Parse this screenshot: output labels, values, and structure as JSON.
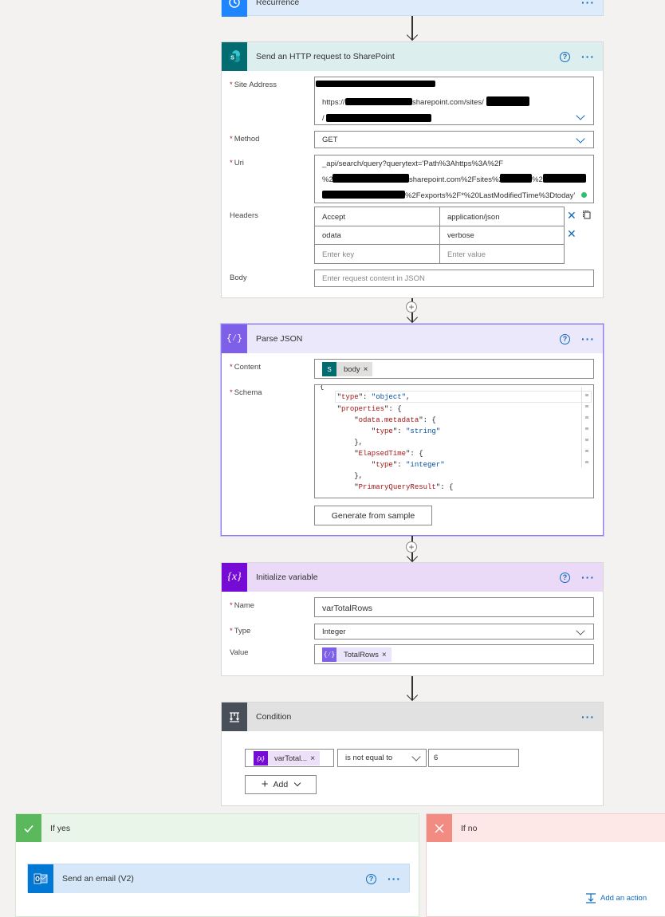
{
  "recurrence": {
    "title": "Recurrence"
  },
  "sharepoint": {
    "title": "Send an HTTP request to SharePoint",
    "site_address_label": "Site Address",
    "site_line2": "https://",
    "site_line2b": "sharepoint.com/sites/",
    "site_line3": "/",
    "method_label": "Method",
    "method_value": "GET",
    "uri_label": "Uri",
    "uri_line1": "_api/search/query?querytext='Path%3Ahttps%3A%2F",
    "uri_line2a": "%2F",
    "uri_line2b": "sharepoint.com%2Fsites%2F",
    "uri_line2c": "%2F",
    "uri_line3": "%2Fexports%2F*%20LastModifiedTime%3Dtoday'",
    "headers_label": "Headers",
    "headers": [
      {
        "key": "Accept",
        "value": "application/json"
      },
      {
        "key": "odata",
        "value": "verbose"
      }
    ],
    "key_placeholder": "Enter key",
    "value_placeholder": "Enter value",
    "body_label": "Body",
    "body_placeholder": "Enter request content in JSON"
  },
  "parse_json": {
    "title": "Parse JSON",
    "content_label": "Content",
    "content_token": "body",
    "schema_label": "Schema",
    "schema_lines": [
      "{",
      "    \"type\": \"object\",",
      "    \"properties\": {",
      "        \"odata.metadata\": {",
      "            \"type\": \"string\"",
      "        },",
      "        \"ElapsedTime\": {",
      "            \"type\": \"integer\"",
      "        },",
      "        \"PrimaryQueryResult\": {"
    ],
    "generate_button": "Generate from sample"
  },
  "init_variable": {
    "title": "Initialize variable",
    "name_label": "Name",
    "name_value": "varTotalRows",
    "type_label": "Type",
    "type_value": "Integer",
    "value_label": "Value",
    "value_token": "TotalRows"
  },
  "condition": {
    "title": "Condition",
    "left_token": "varTotal...",
    "operator": "is not equal to",
    "right_value": "6",
    "add_button": "Add"
  },
  "if_yes": {
    "title": "If yes",
    "action_title": "Send an email (V2)"
  },
  "if_no": {
    "title": "If no",
    "add_action": "Add an action"
  },
  "colors": {
    "sharepoint": "#036c70",
    "parse_json": "#7e5fe7",
    "variable": "#770bd6",
    "condition": "#484f58",
    "yes": "#5cb85c",
    "no": "#f28b82",
    "outlook": "#0078d4",
    "link": "#0f6cbd"
  },
  "icons": [
    "recurrence-clock-icon",
    "sharepoint-icon",
    "parse-json-icon",
    "variable-icon",
    "condition-icon",
    "check-icon",
    "close-icon",
    "outlook-icon",
    "add-action-icon"
  ]
}
